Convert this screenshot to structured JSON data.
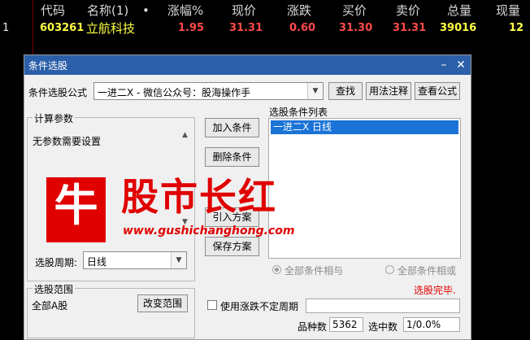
{
  "stock_table": {
    "columns": [
      "代码",
      "名称(1)",
      "•",
      "涨幅%",
      "现价",
      "涨跌",
      "买价",
      "卖价",
      "总量",
      "现量"
    ],
    "row": {
      "index": "1",
      "code": "603261",
      "name": "立航科技",
      "change_pct": "1.95",
      "price": "31.31",
      "change": "0.60",
      "bid": "31.30",
      "ask": "31.31",
      "volume": "39016",
      "cur_volume": "12"
    }
  },
  "dialog": {
    "title": "条件选股",
    "formula_label": "条件选股公式",
    "formula_value": "一进二X  -  微信公众号：股海操作手",
    "find_button": "查找",
    "usage_button": "用法注释",
    "view_formula_button": "查看公式",
    "params_group_title": "计算参数",
    "params_text": "无参数需要设置",
    "add_condition_button": "加入条件",
    "delete_condition_button": "删除条件",
    "import_plan_button": "引入方案",
    "save_plan_button": "保存方案",
    "condition_list_label": "选股条件列表",
    "condition_items": [
      "一进二X  日线"
    ],
    "period_label": "选股周期:",
    "period_value": "日线",
    "radio_and_label": "全部条件相与",
    "radio_or_label": "全部条件相或",
    "status_text": "选股完毕.",
    "scope_group_title": "选股范围",
    "scope_value": "全部A股",
    "change_scope_button": "改变范围",
    "uncertain_period_label": "使用涨跌不定周期",
    "stock_count_label": "品种数",
    "stock_count_value": "5362",
    "selected_count_label": "选中数",
    "selected_count_value": "1/0.0%"
  },
  "watermark": {
    "logo_char": "牛",
    "title": "股市长红",
    "url": "www.gushichanghong.com"
  },
  "colors": {
    "title_bar": "#2b5fa8",
    "selection": "#1a73d6",
    "up_red": "#ff4a4a",
    "code_yellow": "#ffff44",
    "status_red": "#e00000"
  }
}
